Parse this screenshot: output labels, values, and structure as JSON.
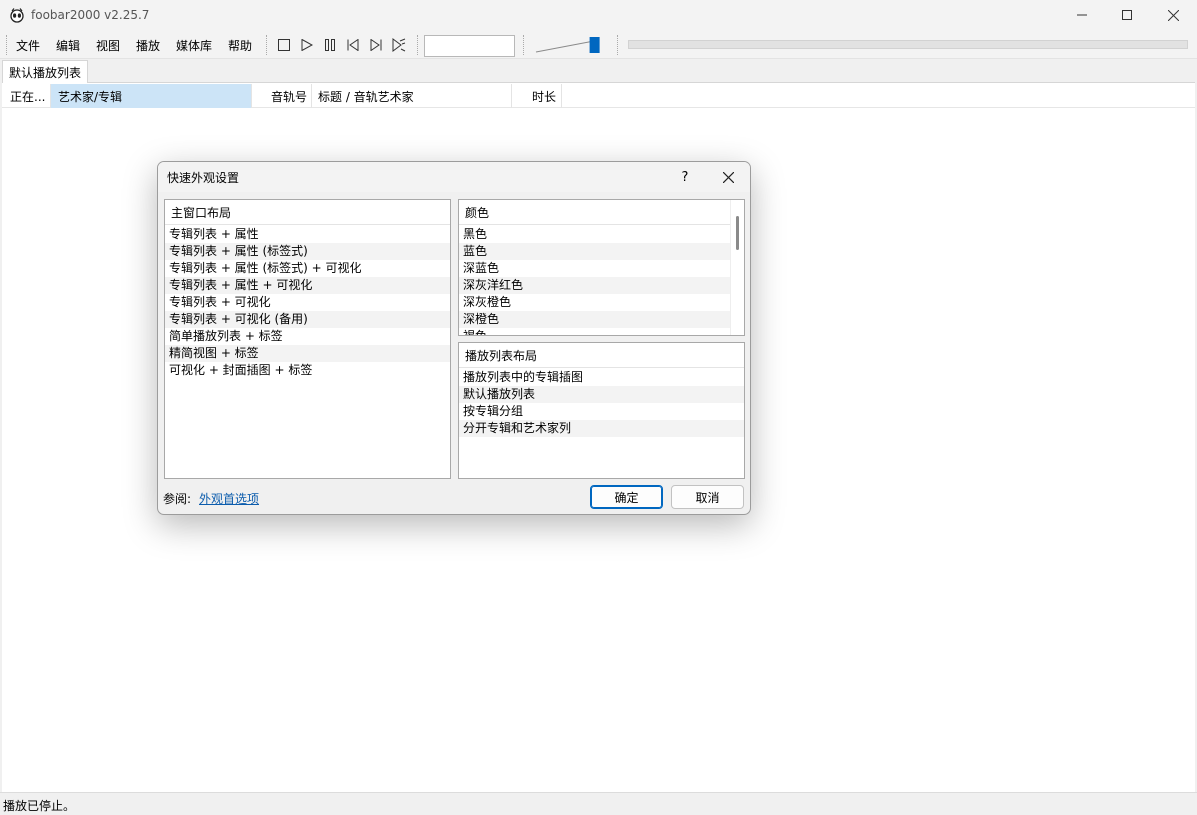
{
  "window": {
    "title": "foobar2000 v2.25.7"
  },
  "menu": {
    "items": [
      {
        "label": "文件"
      },
      {
        "label": "编辑"
      },
      {
        "label": "视图"
      },
      {
        "label": "播放"
      },
      {
        "label": "媒体库"
      },
      {
        "label": "帮助"
      }
    ]
  },
  "toolbar": {
    "buttons": [
      "stop-icon",
      "play-icon",
      "pause-icon",
      "previous-icon",
      "next-icon",
      "random-icon"
    ],
    "volume_level": 0.9
  },
  "tabs": [
    {
      "label": "默认播放列表"
    }
  ],
  "columns": [
    {
      "label": "正在..."
    },
    {
      "label": "艺术家/专辑"
    },
    {
      "label": "音轨号"
    },
    {
      "label": "标题 / 音轨艺术家"
    },
    {
      "label": "时长"
    }
  ],
  "status": {
    "text": "播放已停止。"
  },
  "dialog": {
    "title": "快速外观设置",
    "help_label": "?",
    "layout_list": {
      "header": "主窗口布局",
      "items": [
        "专辑列表 + 属性",
        "专辑列表 + 属性 (标签式)",
        "专辑列表 + 属性 (标签式) + 可视化",
        "专辑列表 + 属性 + 可视化",
        "专辑列表 + 可视化",
        "专辑列表 + 可视化 (备用)",
        "简单播放列表 + 标签",
        "精简视图 + 标签",
        "可视化 + 封面插图 + 标签"
      ]
    },
    "color_list": {
      "header": "颜色",
      "items": [
        "黑色",
        "蓝色",
        "深蓝色",
        "深灰洋红色",
        "深灰橙色",
        "深橙色",
        "褐色"
      ]
    },
    "playlist_list": {
      "header": "播放列表布局",
      "items": [
        "播放列表中的专辑插图",
        "默认播放列表",
        "按专辑分组",
        "分开专辑和艺术家列"
      ]
    },
    "footer": {
      "label": "参阅:",
      "link": "外观首选项"
    },
    "ok_label": "确定",
    "cancel_label": "取消"
  }
}
